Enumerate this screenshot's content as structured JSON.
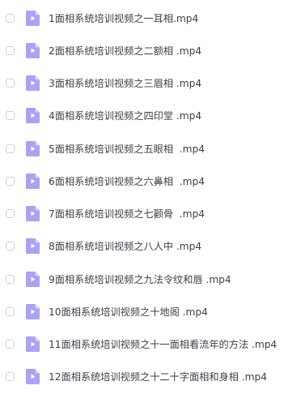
{
  "files": [
    {
      "name": "1面相系统培训视频之一耳相.mp4",
      "icon": "video-file-icon"
    },
    {
      "name": "2面相系统培训视频之二额相 .mp4",
      "icon": "video-file-icon"
    },
    {
      "name": "3面相系统培训视频之三眉相 .mp4",
      "icon": "video-file-icon"
    },
    {
      "name": "4面相系统培训视频之四印堂 .mp4",
      "icon": "video-file-icon"
    },
    {
      "name": "5面相系统培训视频之五眼相  .mp4",
      "icon": "video-file-icon"
    },
    {
      "name": "6面相系统培训视频之六鼻相  .mp4",
      "icon": "video-file-icon"
    },
    {
      "name": "7面相系统培训视频之七颧骨  .mp4",
      "icon": "video-file-icon"
    },
    {
      "name": "8面相系统培训视频之八人中 .mp4",
      "icon": "video-file-icon"
    },
    {
      "name": "9面相系统培训视频之九法令纹和唇 .mp4",
      "icon": "video-file-icon"
    },
    {
      "name": "10面相系统培训视频之十地阁 .mp4",
      "icon": "video-file-icon"
    },
    {
      "name": "11面相系统培训视频之十一面相看流年的方法 .mp4",
      "icon": "video-file-icon"
    },
    {
      "name": "12面相系统培训视频之十二十字面相和身相 .mp4",
      "icon": "video-file-icon"
    }
  ],
  "colors": {
    "icon_body": "#a9a3f5",
    "icon_fold": "#d6d2fb",
    "icon_play": "#ffffff",
    "text": "#3b3f47",
    "checkbox_border": "#cfd2d8"
  }
}
